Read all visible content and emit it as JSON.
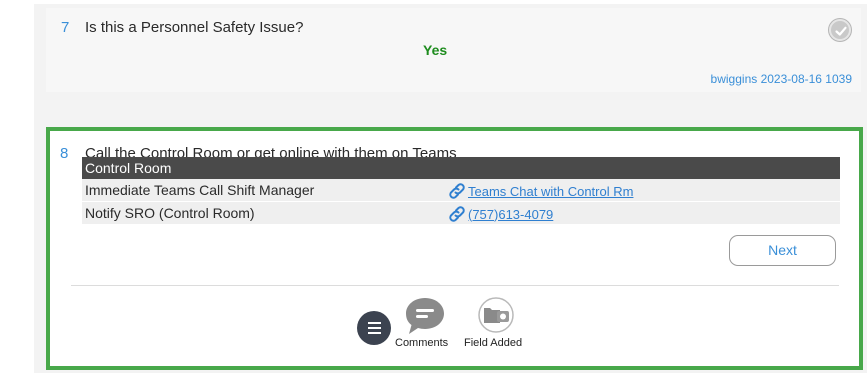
{
  "step7": {
    "number": "7",
    "question": "Is this a Personnel Safety Issue?",
    "answer": "Yes",
    "meta": "bwiggins 2023-08-16 1039",
    "status_icon": "check-circle-icon"
  },
  "step8": {
    "number": "8",
    "question": "Call the Control Room or get online with them on Teams",
    "table": {
      "header": "Control Room",
      "rows": [
        {
          "label": "Immediate Teams Call Shift Manager",
          "link": "Teams Chat with Control Rm",
          "icon": "link-icon"
        },
        {
          "label": "Notify SRO (Control Room)",
          "link": "(757)613-4079",
          "icon": "link-icon"
        }
      ]
    },
    "next_label": "Next",
    "actions": {
      "menu_icon": "hamburger-menu-icon",
      "comments_label": "Comments",
      "field_added_label": "Field Added"
    }
  },
  "colors": {
    "accent_blue": "#3a8fd8",
    "answer_green": "#1e8c1e",
    "highlight_border": "#48a84a",
    "table_header": "#4a4a4a"
  }
}
